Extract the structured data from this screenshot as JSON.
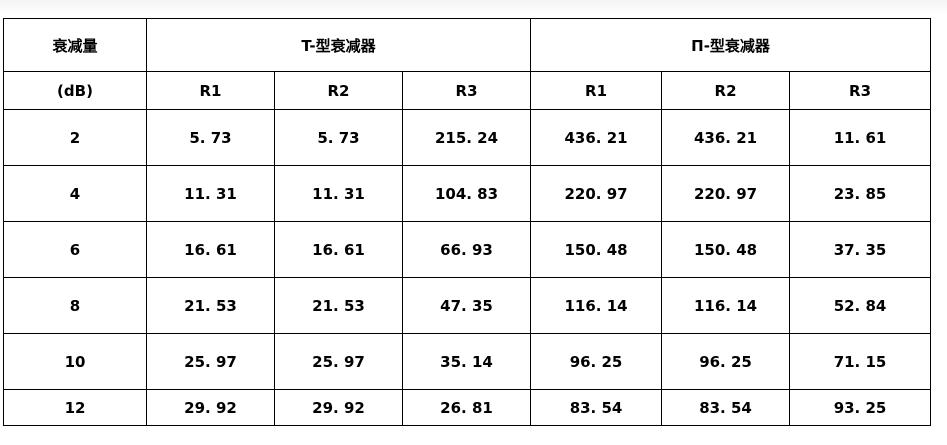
{
  "table": {
    "header": {
      "attenuation_label": "衰减量",
      "unit_label": "(dB)",
      "t_group_label": "T-型衰减器",
      "pi_group_label": "П-型衰减器",
      "t_cols": [
        "R1",
        "R2",
        "R3"
      ],
      "pi_cols": [
        "R1",
        "R2",
        "R3"
      ]
    },
    "rows": [
      [
        "2",
        "5. 73",
        "5. 73",
        "215. 24",
        "436. 21",
        "436. 21",
        "11. 61"
      ],
      [
        "4",
        "11. 31",
        "11. 31",
        "104. 83",
        "220. 97",
        "220. 97",
        "23. 85"
      ],
      [
        "6",
        "16. 61",
        "16. 61",
        "66. 93",
        "150. 48",
        "150. 48",
        "37. 35"
      ],
      [
        "8",
        "21. 53",
        "21. 53",
        "47. 35",
        "116. 14",
        "116. 14",
        "52. 84"
      ],
      [
        "10",
        "25. 97",
        "25. 97",
        "35. 14",
        "96. 25",
        "96. 25",
        "71. 15"
      ],
      [
        "12",
        "29. 92",
        "29. 92",
        "26. 81",
        "83. 54",
        "83. 54",
        "93. 25"
      ]
    ]
  }
}
